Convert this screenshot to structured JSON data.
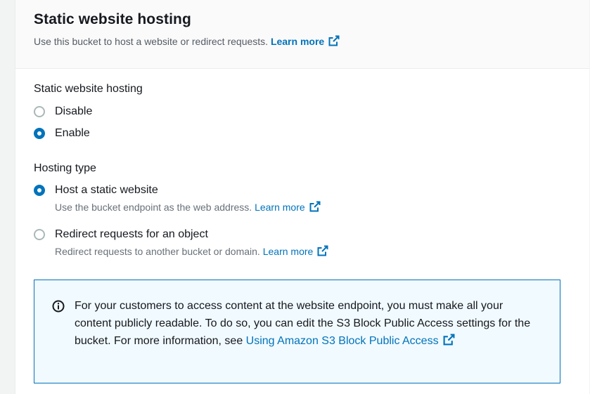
{
  "panel": {
    "title": "Static website hosting",
    "description": "Use this bucket to host a website or redirect requests.",
    "learn_more": "Learn more"
  },
  "hosting_toggle": {
    "label": "Static website hosting",
    "options": [
      {
        "label": "Disable",
        "checked": false
      },
      {
        "label": "Enable",
        "checked": true
      }
    ]
  },
  "hosting_type": {
    "label": "Hosting type",
    "options": [
      {
        "label": "Host a static website",
        "description": "Use the bucket endpoint as the web address.",
        "learn_more": "Learn more",
        "checked": true
      },
      {
        "label": "Redirect requests for an object",
        "description": "Redirect requests to another bucket or domain.",
        "learn_more": "Learn more",
        "checked": false
      }
    ]
  },
  "info_alert": {
    "text": "For your customers to access content at the website endpoint, you must make all your content publicly readable. To do so, you can edit the S3 Block Public Access settings for the bucket. For more information, see",
    "link": "Using Amazon S3 Block Public Access"
  },
  "colors": {
    "link": "#0073bb",
    "info_background": "#f1faff",
    "info_border": "#0073bb"
  },
  "icons": [
    "external-link-icon",
    "info-icon"
  ]
}
